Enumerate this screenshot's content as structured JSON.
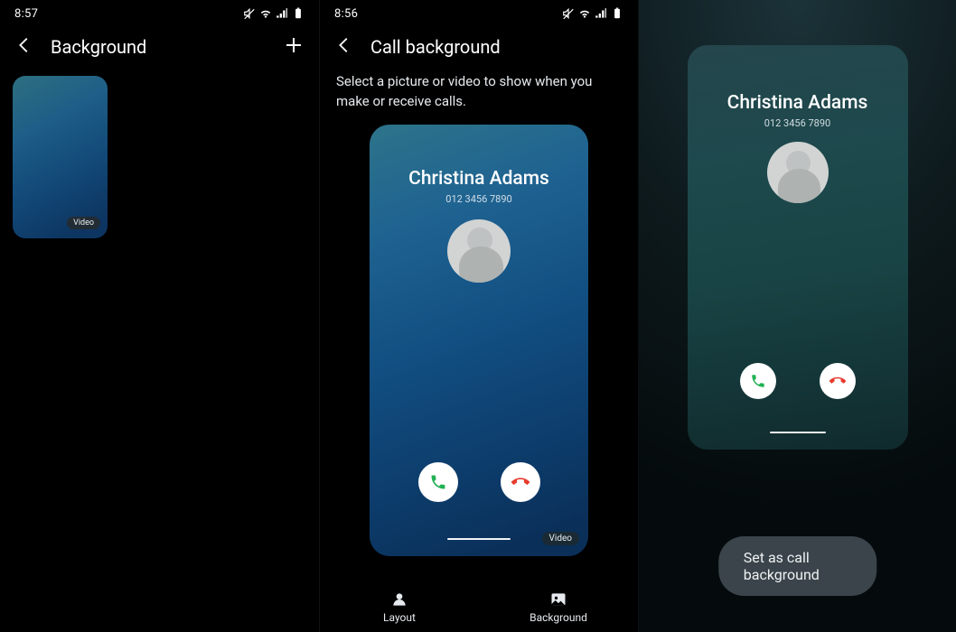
{
  "panel1": {
    "status_time": "8:57",
    "header_title": "Background",
    "thumb_badge": "Video"
  },
  "panel2": {
    "status_time": "8:56",
    "header_title": "Call background",
    "instruction": "Select a picture or video to show when you make or receive calls.",
    "preview": {
      "caller_name": "Christina Adams",
      "caller_number": "012 3456 7890",
      "badge": "Video"
    },
    "tab_layout": "Layout",
    "tab_background": "Background"
  },
  "panel3": {
    "preview": {
      "caller_name": "Christina Adams",
      "caller_number": "012 3456 7890"
    },
    "set_button": "Set as call background"
  }
}
